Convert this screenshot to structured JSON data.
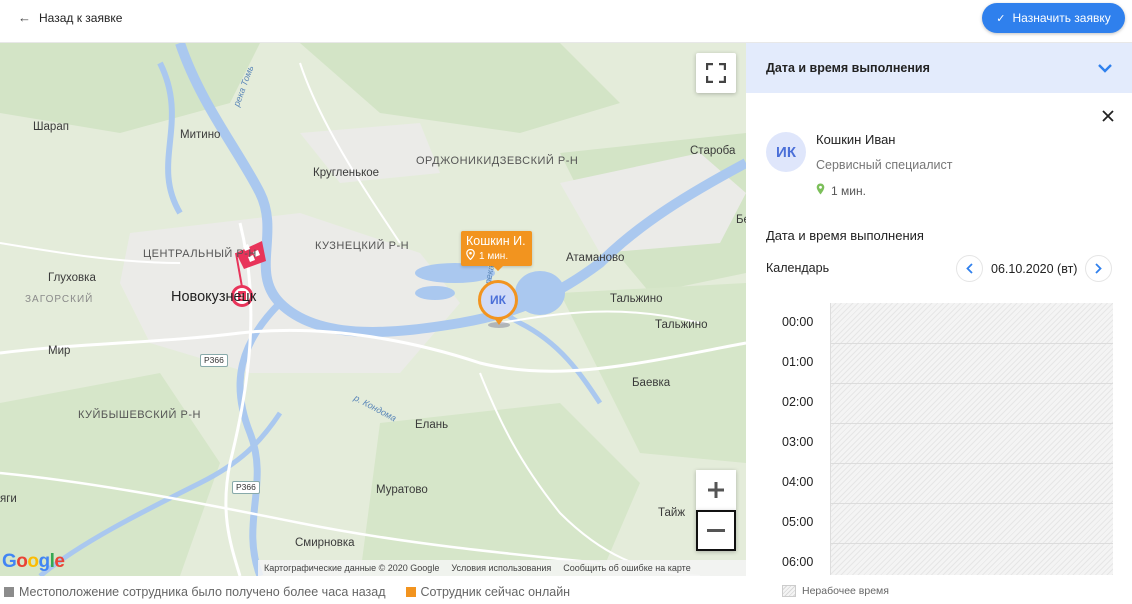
{
  "header": {
    "back_label": "Назад к заявке",
    "assign_label": "Назначить заявку",
    "accent": "#2f80ed"
  },
  "map": {
    "labels": {
      "sharap": "Шарап",
      "mitino": "Митино",
      "ordzh": "ОРДЖОНИКИДЗЕВСКИЙ Р-Н",
      "starobachaty": "Староба",
      "krugl": "Кругленькое",
      "central": "ЦЕНТРАЛЬНЫЙ Р-Н",
      "kuznets": "КУЗНЕЦКИЙ Р-Н",
      "atamanovo": "Атаманово",
      "glukhovka": "Глуховка",
      "zagorsky": "ЗАГОРСКИЙ",
      "novokuz": "Новокузнецк",
      "talzhino1": "Тальжино",
      "talzhino2": "Тальжино",
      "mir": "Мир",
      "baevka": "Баевка",
      "kuibysh": "КУЙБЫШЕВСКИЙ Р-Н",
      "elan": "Елань",
      "yagi": "яги",
      "muratovo": "Муратово",
      "tayzh": "Тайж",
      "smirnovka": "Смирновка",
      "be": "Бе",
      "river_tom": "река Томь",
      "river_kondoma": "р. Кондома",
      "river_tom2": "река Томь"
    },
    "road_tags": [
      "Р366",
      "Р366"
    ],
    "employee_bubble": {
      "name": "Кошкин И.",
      "time": "1 мин."
    },
    "employee_pin_initials": "ИК",
    "google_logo": "Google",
    "attribution": {
      "data": "Картографические данные © 2020 Google",
      "terms": "Условия использования",
      "report": "Сообщить об ошибке на карте"
    },
    "online_color": "#f2941f"
  },
  "legend": {
    "stale_label": "Местоположение сотрудника было получено более часа назад",
    "stale_color": "#8c8c8c",
    "online_label": "Сотрудник сейчас онлайн",
    "online_color": "#f2941f"
  },
  "panel": {
    "header_title": "Дата и время выполнения",
    "employee": {
      "initials": "ИК",
      "name": "Кошкин Иван",
      "role": "Сервисный специалист",
      "time": "1 мин."
    },
    "section_title": "Дата и время выполнения",
    "calendar_label": "Календарь",
    "date": "06.10.2020 (вт)",
    "hours": [
      "00:00",
      "01:00",
      "02:00",
      "03:00",
      "04:00",
      "05:00",
      "06:00"
    ],
    "nonworking_label": "Нерабочее время"
  }
}
